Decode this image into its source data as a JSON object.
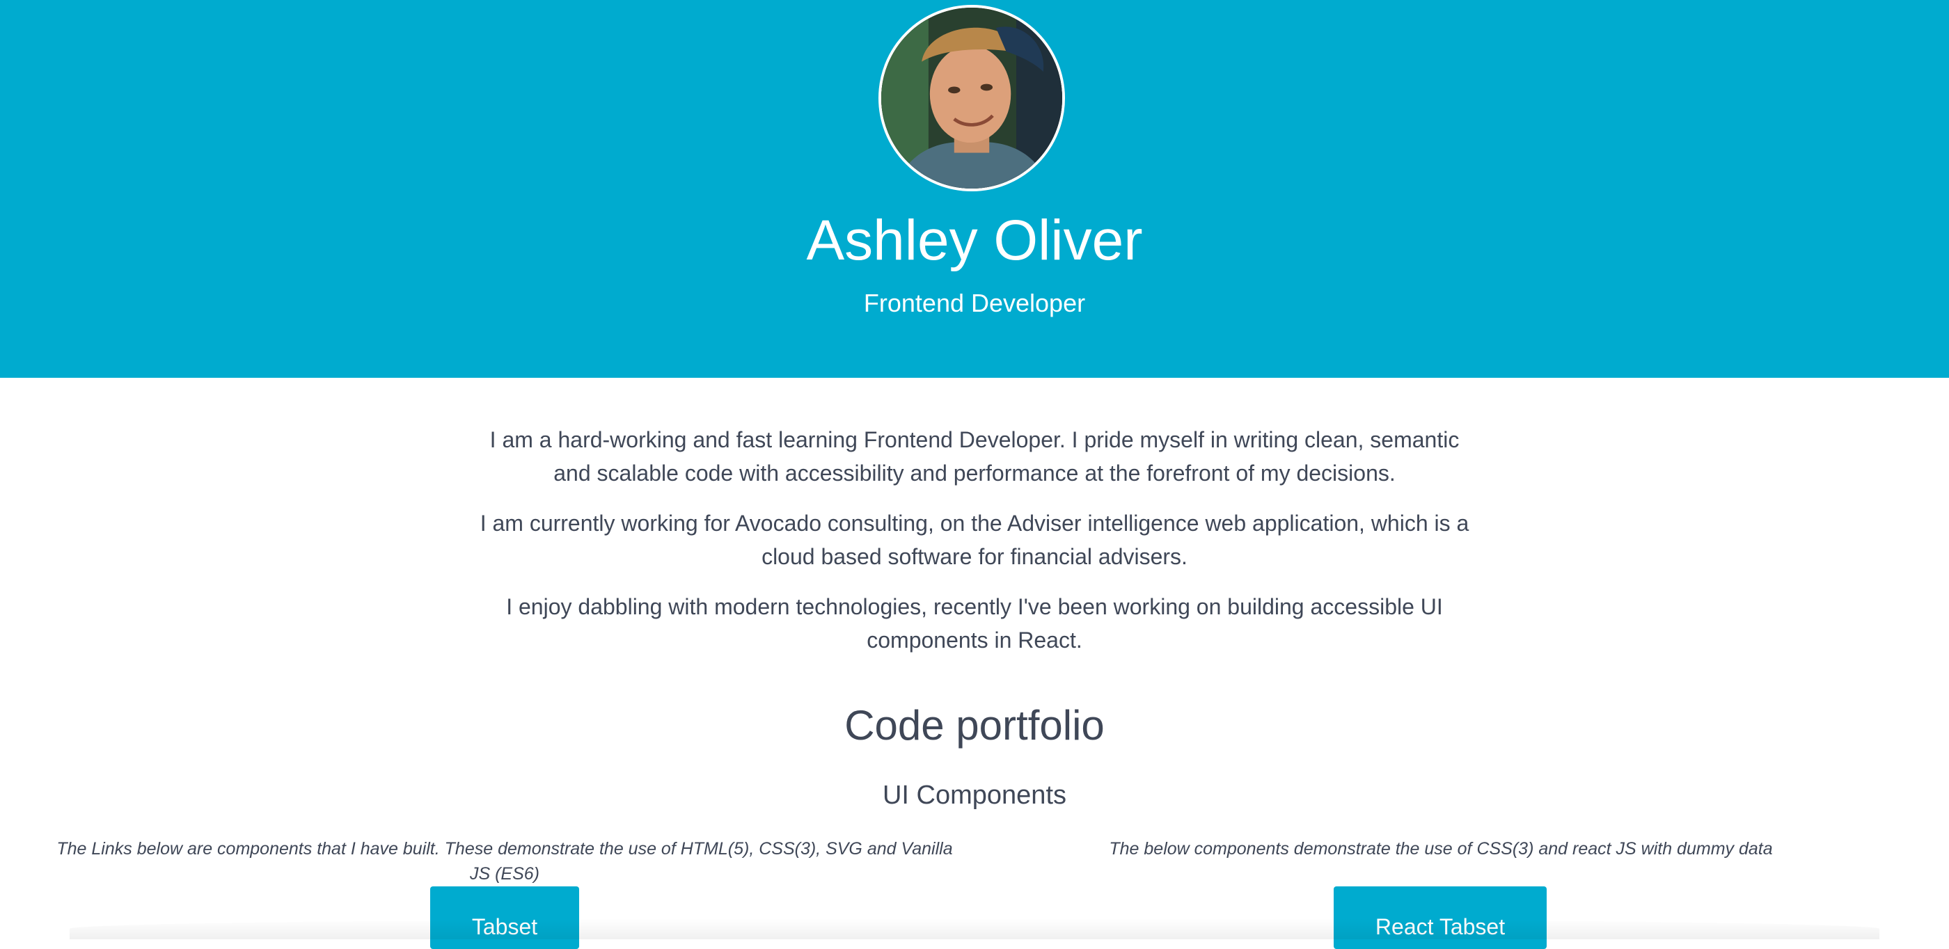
{
  "hero": {
    "name": "Ashley Oliver",
    "role": "Frontend Developer",
    "background_color": "#00abcf"
  },
  "intro": {
    "paragraphs": [
      "I am a hard-working and fast learning Frontend Developer. I pride myself in writing clean, semantic and scalable code with accessibility and performance at the forefront of my decisions.",
      "I am currently working for Avocado consulting, on the Adviser intelligence web application, which is a cloud based software for financial advisers.",
      "I enjoy dabbling with modern technologies, recently I've been working on building accessible UI components in React."
    ]
  },
  "portfolio": {
    "title": "Code portfolio",
    "subtitle": "UI Components",
    "left_description": "The Links below are components that I have built. These demonstrate the use of HTML(5), CSS(3), SVG and Vanilla JS (ES6)",
    "right_description": "The below components demonstrate the use of CSS(3) and react JS with dummy data",
    "left_button_label": "Tabset",
    "right_button_label": "React Tabset",
    "button_color": "#00abcf"
  },
  "text_color": "#3f4757"
}
